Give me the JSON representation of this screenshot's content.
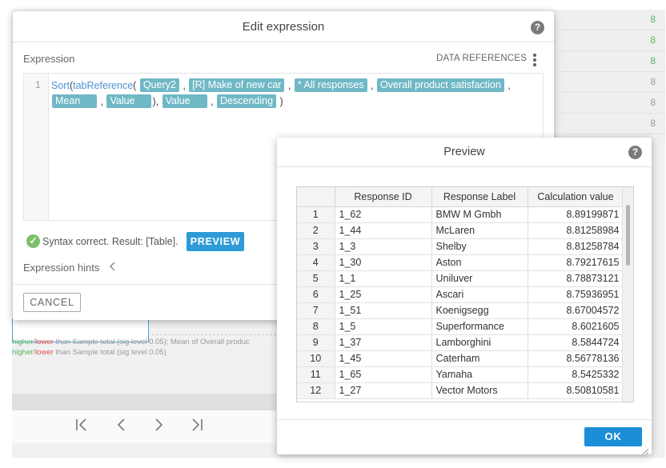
{
  "background": {
    "grid_cells": [
      {
        "text": "8",
        "color": "#58b35d"
      },
      {
        "text": "8",
        "color": "#58b35d"
      },
      {
        "text": "8",
        "color": "#58b35d"
      },
      {
        "text": "8",
        "color": "#999999"
      },
      {
        "text": "8",
        "color": "#999999"
      },
      {
        "text": "8",
        "color": "#999999"
      }
    ],
    "footnote1": {
      "prefix": "higher",
      "sep": "/",
      "lower": "lower",
      "rest": " than Sample total (sig level 0.05);   Mean of Overall produc"
    },
    "footnote2": {
      "prefix": "higher",
      "sep": "/",
      "lower": "lower",
      "rest": " than Sample total (sig level 0.05)"
    },
    "pager": {
      "first": "|<",
      "prev": "<",
      "next": ">",
      "last": ">|"
    }
  },
  "edit_dialog": {
    "title": "Edit expression",
    "help": "?",
    "expression_label": "Expression",
    "data_references_label": "DATA REFERENCES",
    "line_number": "1",
    "code": {
      "fn_sort": "Sort",
      "paren_open": "(",
      "fn_tabref": "tabReference",
      "tokens": [
        "Query2",
        "[R] Make of new car",
        "* All responses",
        "Overall product satisfaction",
        "Mean",
        "Value",
        "Value",
        "Descending"
      ],
      "comma": ",",
      "close_inner": "),",
      "close_outer": ")"
    },
    "status_text": "Syntax correct. Result: [Table].",
    "status_check": "✓",
    "preview_button": "PREVIEW",
    "hints_label": "Expression hints",
    "hints_chevron": "<",
    "cancel_button": "CANCEL"
  },
  "preview_dialog": {
    "title": "Preview",
    "help": "?",
    "columns": [
      "",
      "Response ID",
      "Response Label",
      "Calculation value"
    ],
    "rows": [
      [
        "1",
        "1_62",
        "BMW M Gmbh",
        "8.89199871"
      ],
      [
        "2",
        "1_44",
        "McLaren",
        "8.81258984"
      ],
      [
        "3",
        "1_3",
        "Shelby",
        "8.81258784"
      ],
      [
        "4",
        "1_30",
        "Aston",
        "8.79217615"
      ],
      [
        "5",
        "1_1",
        "Uniluver",
        "8.78873121"
      ],
      [
        "6",
        "1_25",
        "Ascari",
        "8.75936951"
      ],
      [
        "7",
        "1_51",
        "Koenigsegg",
        "8.67004572"
      ],
      [
        "8",
        "1_5",
        "Superformance",
        "8.6021605"
      ],
      [
        "9",
        "1_37",
        "Lamborghini",
        "8.5844724"
      ],
      [
        "10",
        "1_45",
        "Caterham",
        "8.56778136"
      ],
      [
        "11",
        "1_65",
        "Yamaha",
        "8.5425332"
      ],
      [
        "12",
        "1_27",
        "Vector Motors",
        "8.50810581"
      ]
    ],
    "ok_button": "OK"
  }
}
